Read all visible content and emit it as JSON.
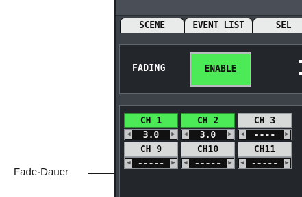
{
  "callout": {
    "label": "Fade-Dauer"
  },
  "tabs": {
    "scene": "SCENE",
    "event_list": "EVENT LIST",
    "sel": "SEL"
  },
  "fading": {
    "label": "FADING",
    "button": "ENABLE"
  },
  "grid": {
    "row1_channels": [
      "CH 1",
      "CH 2",
      "CH 3"
    ],
    "row1_values": [
      "3.0",
      "3.0",
      "----"
    ],
    "row2_channels": [
      "CH 9",
      "CH10",
      "CH11"
    ],
    "row2_values": [
      "-----",
      "-----",
      "-----"
    ]
  },
  "colors": {
    "active_green": "#4dea58",
    "panel_bg": "#3d4249",
    "box_bg": "#23262b"
  },
  "icons": {
    "left_arrow": "arrow-left-icon",
    "right_arrow": "arrow-right-icon"
  }
}
